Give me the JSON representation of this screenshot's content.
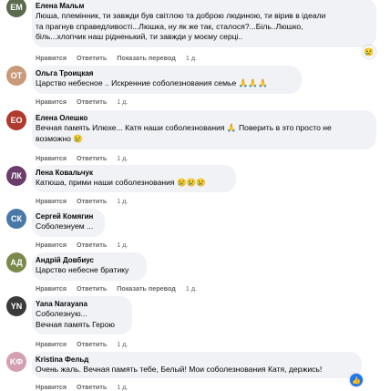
{
  "action_labels": {
    "like": "Нравится",
    "reply": "Ответить",
    "translate": "Показать перевод"
  },
  "comments": [
    {
      "name": "Елена Мальм",
      "text": "Люша, племінник, ти завжди був світлою та доброю людиною, ти вірив в ідеали\nта прагнув справедливості...Люшка, ну як же так, сталося?...Біль..Люшко,\nбіль...хлопчик наш рідненький, ти завжди у моєму серці..",
      "time": "1 д.",
      "translate": true,
      "avatar_color": "#5b6b4e"
    },
    {
      "name": "Ольга Троицкая",
      "text": "Царство небесное .. Искренние соболезнования семье 🙏🙏🙏",
      "time": "1 д.",
      "translate": false,
      "avatar_color": "#c89a7a"
    },
    {
      "name": "Елена Олешко",
      "text": "Вечная память Илюхе... Катя наши соболезнования 🙏 Поверить в это просто не\nвозможно 😢",
      "time": "1 д.",
      "translate": false,
      "avatar_color": "#b03a2e"
    },
    {
      "name": "Лена Ковальчук",
      "text": "Катюша, прими наши соболезнования 😢😢😢",
      "time": "1 д.",
      "translate": false,
      "avatar_color": "#6a3d6b"
    },
    {
      "name": "Сергей Комягин",
      "text": "Соболезнуем ...",
      "time": "1 д.",
      "translate": false,
      "avatar_color": "#4a79a8"
    },
    {
      "name": "Андрій Довбиус",
      "text": "Царство небесне братику",
      "time": "1 д.",
      "translate": true,
      "avatar_color": "#7a8a4a"
    },
    {
      "name": "Yana Narayana",
      "text": "Соболезную...\nВечная память Герою",
      "time": "1 д.",
      "translate": false,
      "avatar_color": "#3a3a3a"
    },
    {
      "name": "Kristina Фельд",
      "text": "Очень жаль. Вечная память тебе, Белый! Мои соболезнования Катя, держись!",
      "time": "1 д.",
      "translate": false,
      "avatar_color": "#d4a0b0"
    }
  ],
  "reactions": {
    "sad": "😢",
    "like": "👍"
  }
}
